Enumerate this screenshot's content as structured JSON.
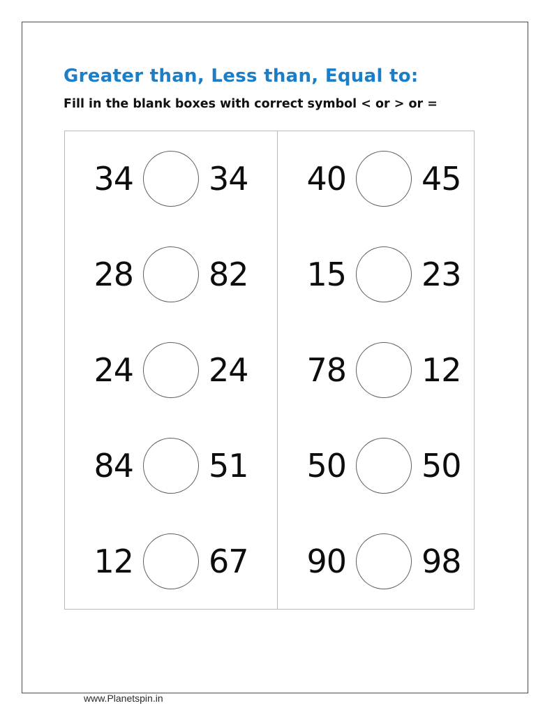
{
  "header": {
    "title": "Greater than, Less than, Equal to:",
    "title_color": "#1b7ec7",
    "instruction": "Fill in the blank boxes with correct symbol < or > or ="
  },
  "worksheet": {
    "answer_placeholder": "",
    "columns": [
      {
        "name": "left-column",
        "rows": [
          {
            "left": "34",
            "right": "34"
          },
          {
            "left": "28",
            "right": "82"
          },
          {
            "left": "24",
            "right": "24"
          },
          {
            "left": "84",
            "right": "51"
          },
          {
            "left": "12",
            "right": "67"
          }
        ]
      },
      {
        "name": "right-column",
        "rows": [
          {
            "left": "40",
            "right": "45"
          },
          {
            "left": "15",
            "right": "23"
          },
          {
            "left": "78",
            "right": "12"
          },
          {
            "left": "50",
            "right": "50"
          },
          {
            "left": "90",
            "right": "98"
          }
        ]
      }
    ]
  },
  "footer": {
    "website": "www.Planetspin.in"
  },
  "colors": {
    "title_blue": "#1b7ec7",
    "text_black": "#0d0d0d",
    "frame_border": "#4a4a4a",
    "table_border": "#b8b8b8",
    "circle_stroke": "#5f5f5f"
  }
}
